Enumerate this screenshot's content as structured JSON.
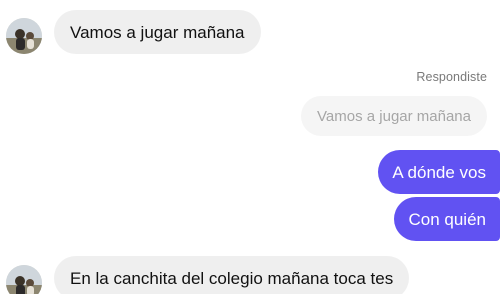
{
  "messages": [
    {
      "id": "m1",
      "direction": "incoming",
      "text": "Vamos a jugar mañana"
    },
    {
      "id": "m2",
      "direction": "outgoing",
      "reply_label": "Respondiste",
      "quoted_text": "Vamos a jugar mañana"
    },
    {
      "id": "m3",
      "direction": "outgoing",
      "text": "A dónde vos"
    },
    {
      "id": "m4",
      "direction": "outgoing",
      "text": "Con quién"
    },
    {
      "id": "m5",
      "direction": "incoming",
      "text": "En la canchita del colegio mañana toca tes"
    }
  ],
  "colors": {
    "incoming_bubble": "#efefef",
    "outgoing_bubble": "#6152f2",
    "reply_quote_bubble": "#f5f5f5",
    "reply_label_text": "#7a7a7a"
  },
  "icons": {
    "avatar": "profile-photo"
  }
}
